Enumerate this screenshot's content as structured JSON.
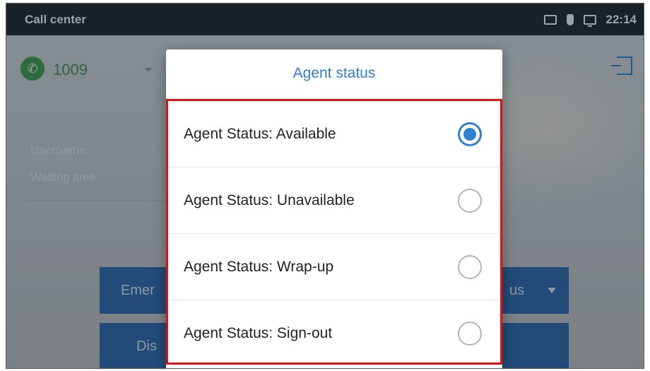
{
  "status_bar": {
    "title": "Call center",
    "time": "22:14",
    "icons": [
      "image-icon",
      "poe-plug-icon",
      "screen-icon"
    ]
  },
  "background": {
    "extension_number": "1009",
    "labels": {
      "username": "Username:",
      "waiting_time": "Waiting time:"
    },
    "buttons": {
      "emergency_partial": "Emer",
      "status_partial": "us",
      "dis_partial": "Dis"
    }
  },
  "dialog": {
    "title": "Agent status",
    "options": [
      {
        "label": "Agent Status: Available",
        "checked": true
      },
      {
        "label": "Agent Status: Unavailable",
        "checked": false
      },
      {
        "label": "Agent Status: Wrap-up",
        "checked": false
      },
      {
        "label": "Agent Status: Sign-out",
        "checked": false
      }
    ]
  },
  "colors": {
    "accent": "#2d7fd3",
    "highlight_border": "#e01212",
    "status_bar": "#1f2326",
    "extension_green": "#3fa34a",
    "button_blue": "#2d6bb3"
  }
}
